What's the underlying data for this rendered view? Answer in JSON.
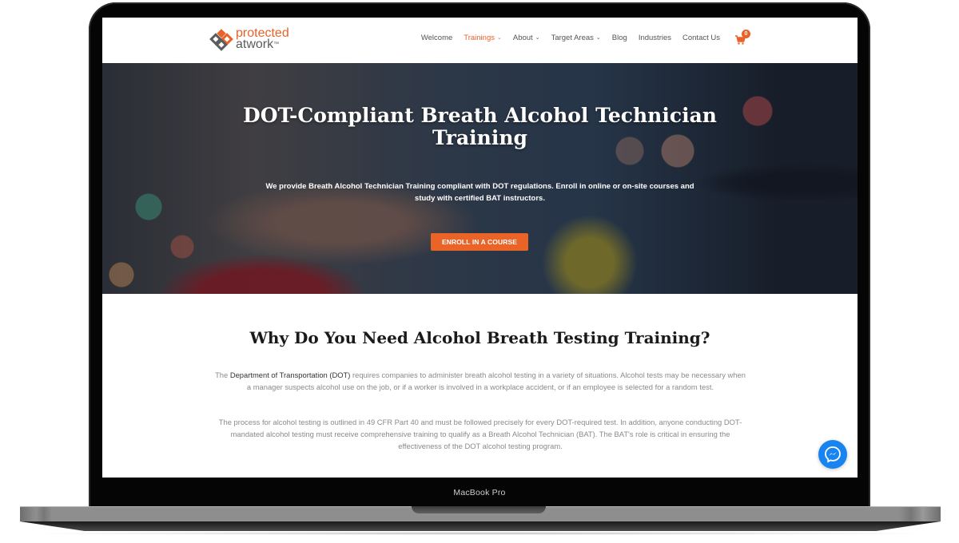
{
  "device": {
    "label": "MacBook Pro"
  },
  "header": {
    "logo": {
      "line1": "protected",
      "line2": "atwork",
      "trademark": "™"
    },
    "nav": [
      {
        "label": "Welcome",
        "active": false,
        "has_dropdown": false
      },
      {
        "label": "Trainings",
        "active": true,
        "has_dropdown": true
      },
      {
        "label": "About",
        "active": false,
        "has_dropdown": true
      },
      {
        "label": "Target Areas",
        "active": false,
        "has_dropdown": true
      },
      {
        "label": "Blog",
        "active": false,
        "has_dropdown": false
      },
      {
        "label": "Industries",
        "active": false,
        "has_dropdown": false
      },
      {
        "label": "Contact Us",
        "active": false,
        "has_dropdown": false
      }
    ],
    "cart": {
      "icon": "shopping-cart-icon",
      "count": "0"
    }
  },
  "hero": {
    "title_line1": "DOT-Compliant Breath Alcohol Technician",
    "title_line2": "Training",
    "subtitle": "We provide Breath Alcohol Technician Training compliant with DOT regulations. Enroll in online or on-site courses and study with certified BAT instructors.",
    "cta_label": "ENROLL IN A COURSE"
  },
  "section": {
    "title": "Why Do You Need Alcohol Breath Testing Training?",
    "p1_prefix": "The ",
    "p1_link": "Department of Transportation (DOT)",
    "p1_rest": " requires companies to administer breath alcohol testing in a variety of situations. Alcohol tests may be necessary when a manager suspects alcohol use on the job, or if a worker is involved in a workplace accident, or if an employee is selected for a random test.",
    "p2": "The process for alcohol testing is outlined in 49 CFR Part 40 and must be followed precisely for every DOT-required test. In addition, anyone conducting DOT-mandated alcohol testing must receive comprehensive training to qualify as a Breath Alcohol Technician (BAT). The BAT's role is critical in ensuring the effectiveness of the DOT alcohol testing program."
  },
  "chat_widget": {
    "icon": "messenger-icon"
  },
  "colors": {
    "brand_orange": "#e8622a",
    "cta_orange": "#ea6428",
    "messenger_blue": "#1884f0",
    "body_text": "#8a8a8a",
    "logo_gray": "#5c5c5c"
  }
}
